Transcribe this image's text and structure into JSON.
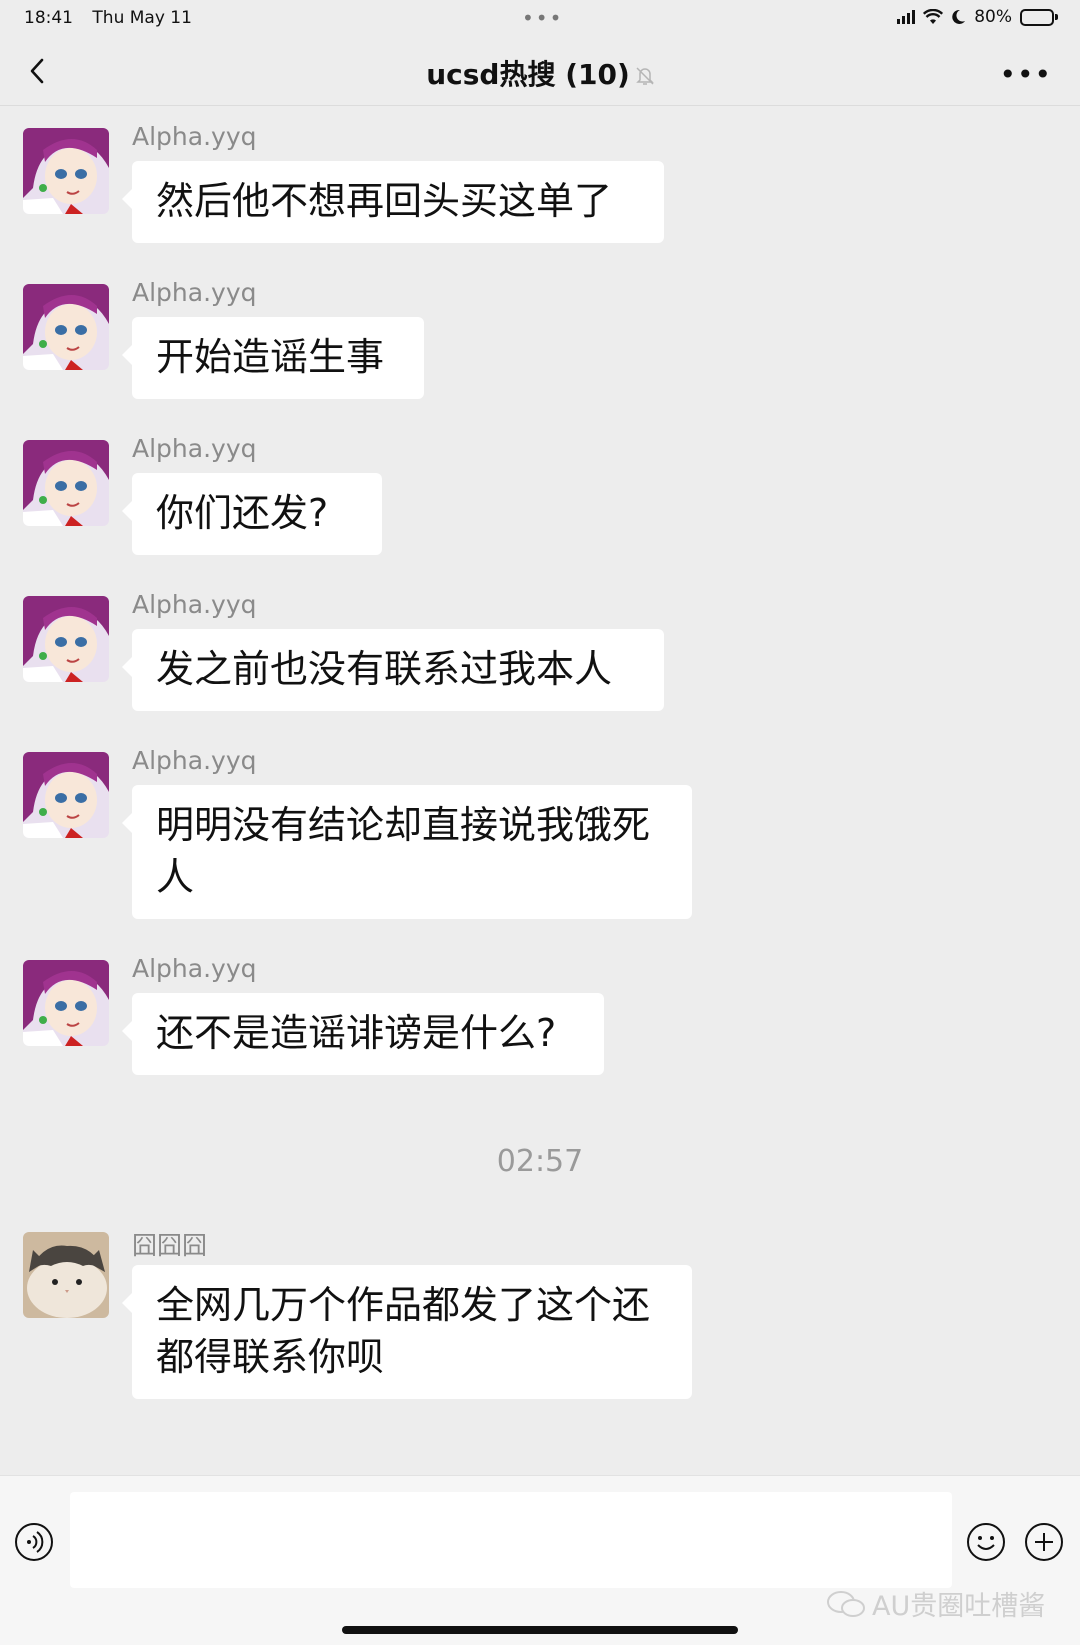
{
  "status_bar": {
    "time": "18:41",
    "date": "Thu May 11",
    "battery": "80%",
    "battery_level": 0.8
  },
  "header": {
    "title": "ucsd热搜 (10)",
    "back_icon": "chevron-left-icon",
    "more_icon": "more-icon",
    "more_label": "•••"
  },
  "messages": [
    {
      "sender": "Alpha.yyq",
      "text": "然后他不想再回头买这单了"
    },
    {
      "sender": "Alpha.yyq",
      "text": "开始造谣生事"
    },
    {
      "sender": "Alpha.yyq",
      "text": "你们还发?"
    },
    {
      "sender": "Alpha.yyq",
      "text": "发之前也没有联系过我本人"
    },
    {
      "sender": "Alpha.yyq",
      "text": "明明没有结论却直接说我饿死人"
    },
    {
      "sender": "Alpha.yyq",
      "text": "还不是造谣诽谤是什么?"
    },
    {
      "sender": "囧囧囧",
      "text": "全网几万个作品都发了这个还都得联系你呗"
    }
  ],
  "timestamp": "02:57",
  "input": {
    "value": "",
    "voice_icon": "voice-icon",
    "emoji_icon": "emoji-icon",
    "plus_icon": "plus-icon"
  },
  "watermark": "AU贵圈吐槽酱",
  "colors": {
    "background": "#ededed",
    "bubble": "#ffffff",
    "sender_name": "#8a8a8a"
  }
}
